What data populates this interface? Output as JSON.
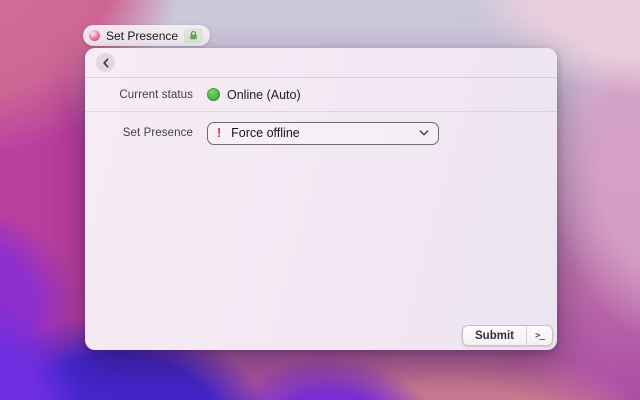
{
  "tab": {
    "title": "Set Presence"
  },
  "form": {
    "current_status": {
      "label": "Current status",
      "value": "Online (Auto)",
      "status_color": "#43b243"
    },
    "set_presence": {
      "label": "Set Presence",
      "selected": "Force offline",
      "alert_glyph": "!",
      "alert_color": "#d02f3d"
    }
  },
  "footer": {
    "submit_label": "Submit",
    "shortcut_glyph": ">_"
  },
  "colors": {
    "window_bg": "#f3e9f3",
    "status_online": "#43b243",
    "alert_red": "#d02f3d",
    "wallpaper_magenta": "#b93f9f",
    "wallpaper_violet": "#4526cd",
    "wallpaper_pink": "#cd6694"
  }
}
